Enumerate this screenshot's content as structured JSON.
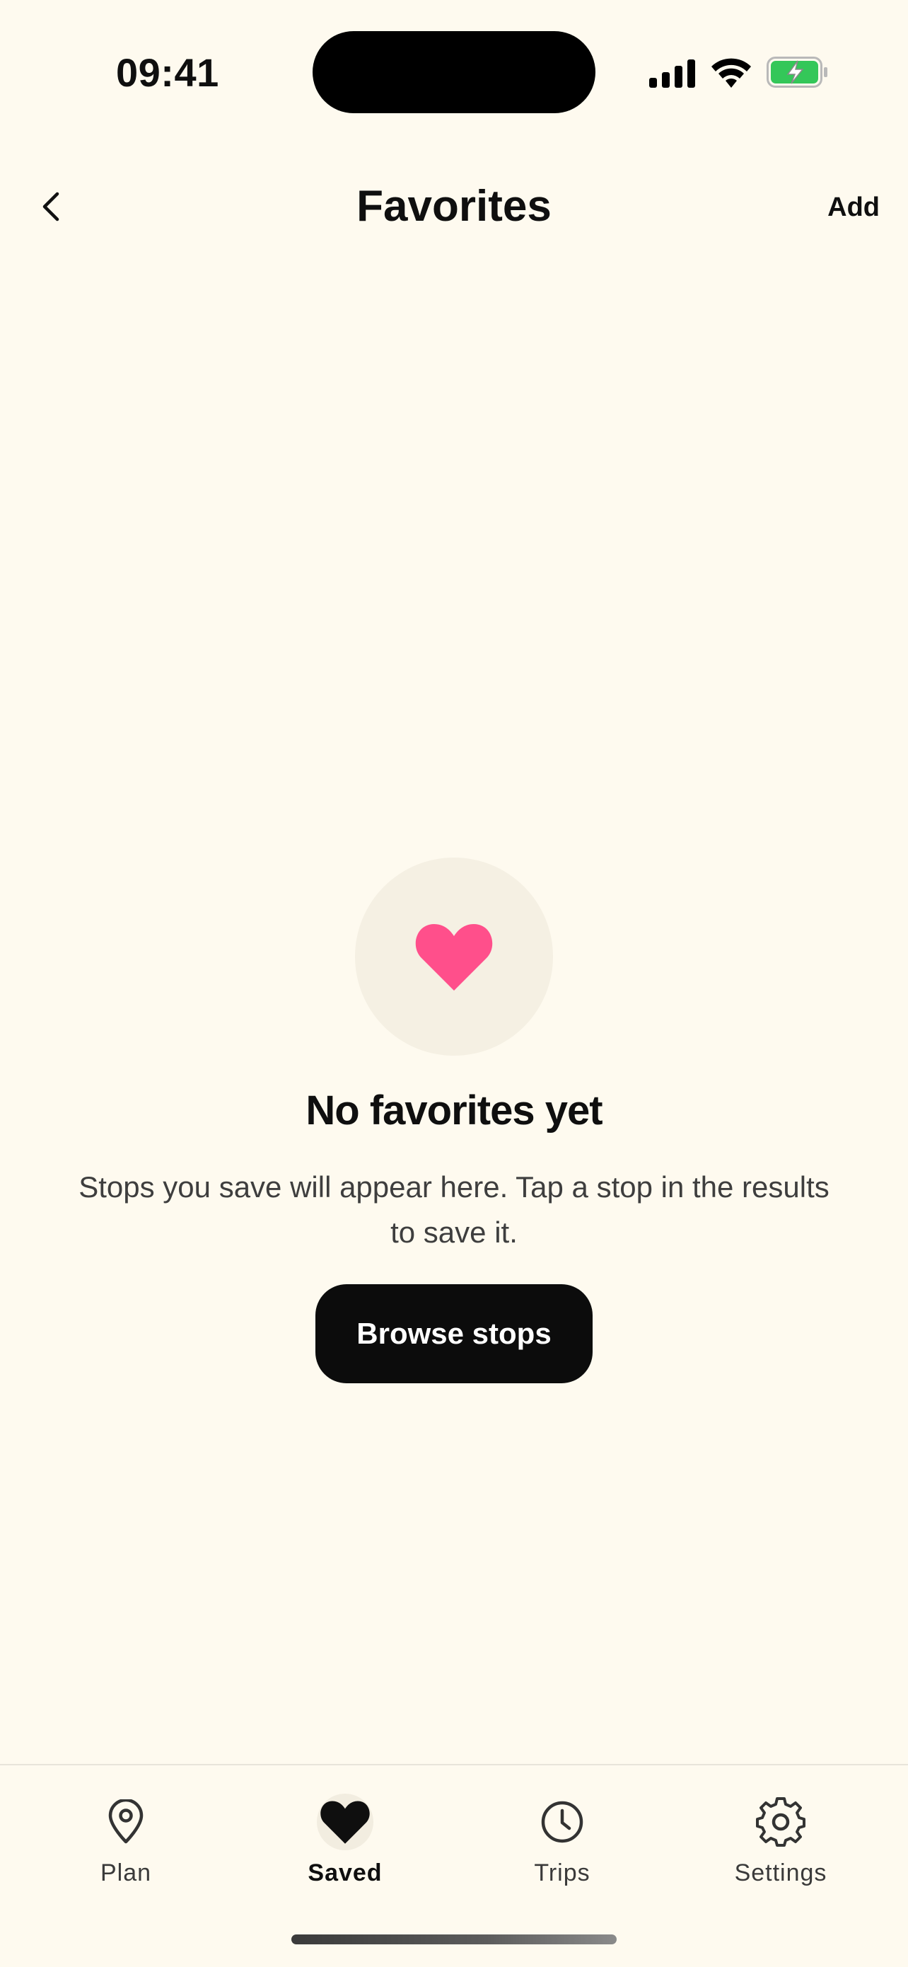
{
  "status_bar": {
    "time": "09:41",
    "icons": [
      "cellular-signal-icon",
      "wifi-icon",
      "battery-charging-icon"
    ],
    "battery_color": "#34C759"
  },
  "header": {
    "title": "Favorites",
    "back_icon": "chevron-left-icon",
    "action_label": "Add"
  },
  "empty_state": {
    "icon": "heart-icon",
    "icon_color": "#FF4F8B",
    "title": "No favorites yet",
    "description": "Stops you save will appear here. Tap a stop in the results to save it.",
    "button_label": "Browse stops"
  },
  "tab_bar": {
    "tabs": [
      {
        "label": "Plan",
        "icon": "map-pin-icon",
        "active": false
      },
      {
        "label": "Saved",
        "icon": "heart-icon",
        "active": true
      },
      {
        "label": "Trips",
        "icon": "clock-icon",
        "active": false
      },
      {
        "label": "Settings",
        "icon": "gear-icon",
        "active": false
      }
    ]
  },
  "colors": {
    "background": "#FEFAEF",
    "primary_button": "#0C0C0C",
    "accent_heart": "#FF4F8B"
  }
}
